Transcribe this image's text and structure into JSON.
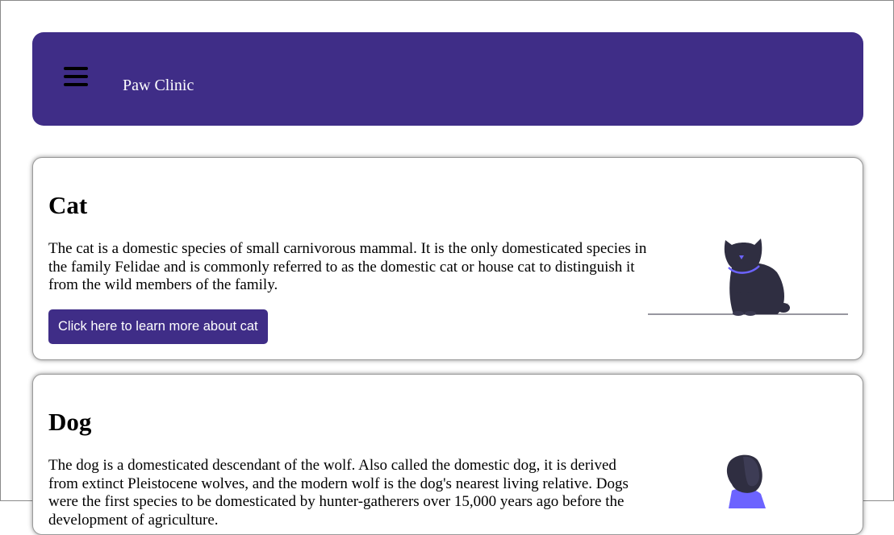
{
  "header": {
    "menu_icon": "hamburger-menu-icon",
    "brand": "Paw Clinic",
    "background_color": "#3f2d87"
  },
  "cards": [
    {
      "title": "Cat",
      "description": "The cat is a domestic species of small carnivorous mammal. It is the only domesticated species in the family Felidae and is commonly referred to as the domestic cat or house cat to distinguish it from the wild members of the family.",
      "button_label": "Click here to learn more about cat",
      "illustration": "sitting-cat-illustration"
    },
    {
      "title": "Dog",
      "description": "The dog is a domesticated descendant of the wolf. Also called the domestic dog, it is derived from extinct Pleistocene wolves, and the modern wolf is the dog's nearest living relative. Dogs were the first species to be domesticated by hunter-gatherers over 15,000 years ago before the development of agriculture.",
      "illustration": "dog-illustration"
    }
  ],
  "colors": {
    "accent": "#3f2d87",
    "illustration_dark": "#2f2e41",
    "illustration_accent": "#6c63ff"
  }
}
